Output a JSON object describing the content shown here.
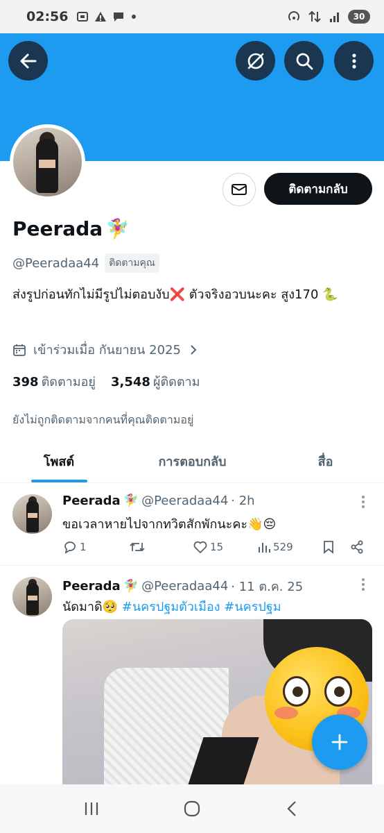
{
  "status_bar": {
    "time": "02:56",
    "battery": "30"
  },
  "profile": {
    "display_name": "Peerada",
    "name_emoji": "🧚‍♀️",
    "handle": "@Peeradaa44",
    "follows_you": "ติดตามคุณ",
    "bio": "ส่งรูปก่อนทักไม่มีรูปไม่ตอบงับ❌ ตัวจริงอวบนะคะ สูง170 🐍",
    "joined": "เข้าร่วมเมื่อ กันยายน 2025",
    "following_count": "398",
    "following_label": "ติดตามอยู่",
    "followers_count": "3,548",
    "followers_label": "ผู้ติดตาม",
    "not_followed_note": "ยังไม่ถูกติดตามจากคนที่คุณติดตามอยู่",
    "follow_back_label": "ติดตามกลับ"
  },
  "tabs": [
    {
      "label": "โพสต์",
      "active": true
    },
    {
      "label": "การตอบกลับ",
      "active": false
    },
    {
      "label": "สื่อ",
      "active": false
    }
  ],
  "tweets": [
    {
      "name": "Peerada",
      "name_emoji": "🧚‍♀️",
      "handle": "@Peeradaa44",
      "time": "· 2h",
      "text": "ขอเวลาหายไปจากทวิตสักพักนะคะ👋😔",
      "replies": "1",
      "retweets": "",
      "likes": "15",
      "views": "529"
    },
    {
      "name": "Peerada",
      "name_emoji": "🧚‍♀️",
      "handle": "@Peeradaa44",
      "time": "· 11 ต.ค. 25",
      "text_prefix": "นัดมาดิ🥺 ",
      "hashtag_1": "#นครปฐมตัวเมือง",
      "hashtag_2": "#นครปฐม"
    }
  ],
  "icons": {
    "back": "arrow-left-icon",
    "grok": "grok-icon",
    "search": "search-icon",
    "more": "more-vertical-icon",
    "mail": "mail-icon",
    "calendar": "calendar-icon",
    "compose": "plus-icon"
  },
  "colors": {
    "accent": "#1d9bf0",
    "banner": "#1d9bf0",
    "button_dark": "#0f1419",
    "secondary_text": "#536471"
  }
}
